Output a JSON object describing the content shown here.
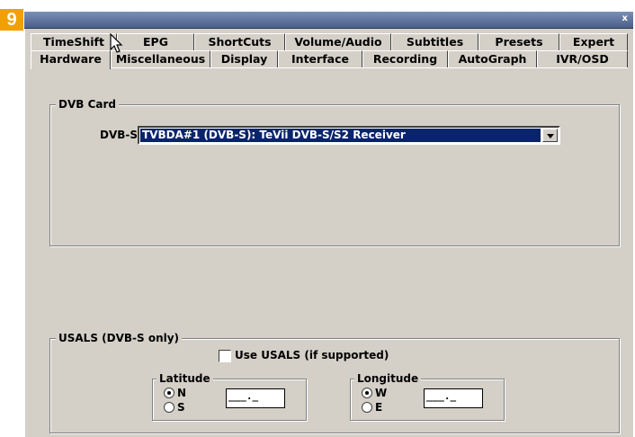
{
  "step_badge": "9",
  "window": {
    "close_glyph": "x"
  },
  "tabs_back": [
    "TimeShift",
    "EPG",
    "ShortCuts",
    "Volume/Audio",
    "Subtitles",
    "Presets",
    "Expert"
  ],
  "tabs_front": [
    "Hardware",
    "Miscellaneous",
    "Display",
    "Interface",
    "Recording",
    "AutoGraph",
    "IVR/OSD"
  ],
  "active_tab": "Hardware",
  "dvb_card": {
    "title": "DVB Card",
    "dvbs_label": "DVB-S",
    "dvbs_value": "TVBDA#1 (DVB-S): TeVii DVB-S/S2 Receiver"
  },
  "usals": {
    "title": "USALS (DVB-S only)",
    "use_label": "Use USALS (if supported)",
    "use_checked": false,
    "latitude": {
      "title": "Latitude",
      "opt1": "N",
      "opt2": "S",
      "selected": "N",
      "value": "___._"
    },
    "longitude": {
      "title": "Longitude",
      "opt1": "W",
      "opt2": "E",
      "selected": "W",
      "value": "___._"
    }
  },
  "icons": [
    "close-icon",
    "dropdown-arrow-icon",
    "mouse-pointer-icon"
  ]
}
